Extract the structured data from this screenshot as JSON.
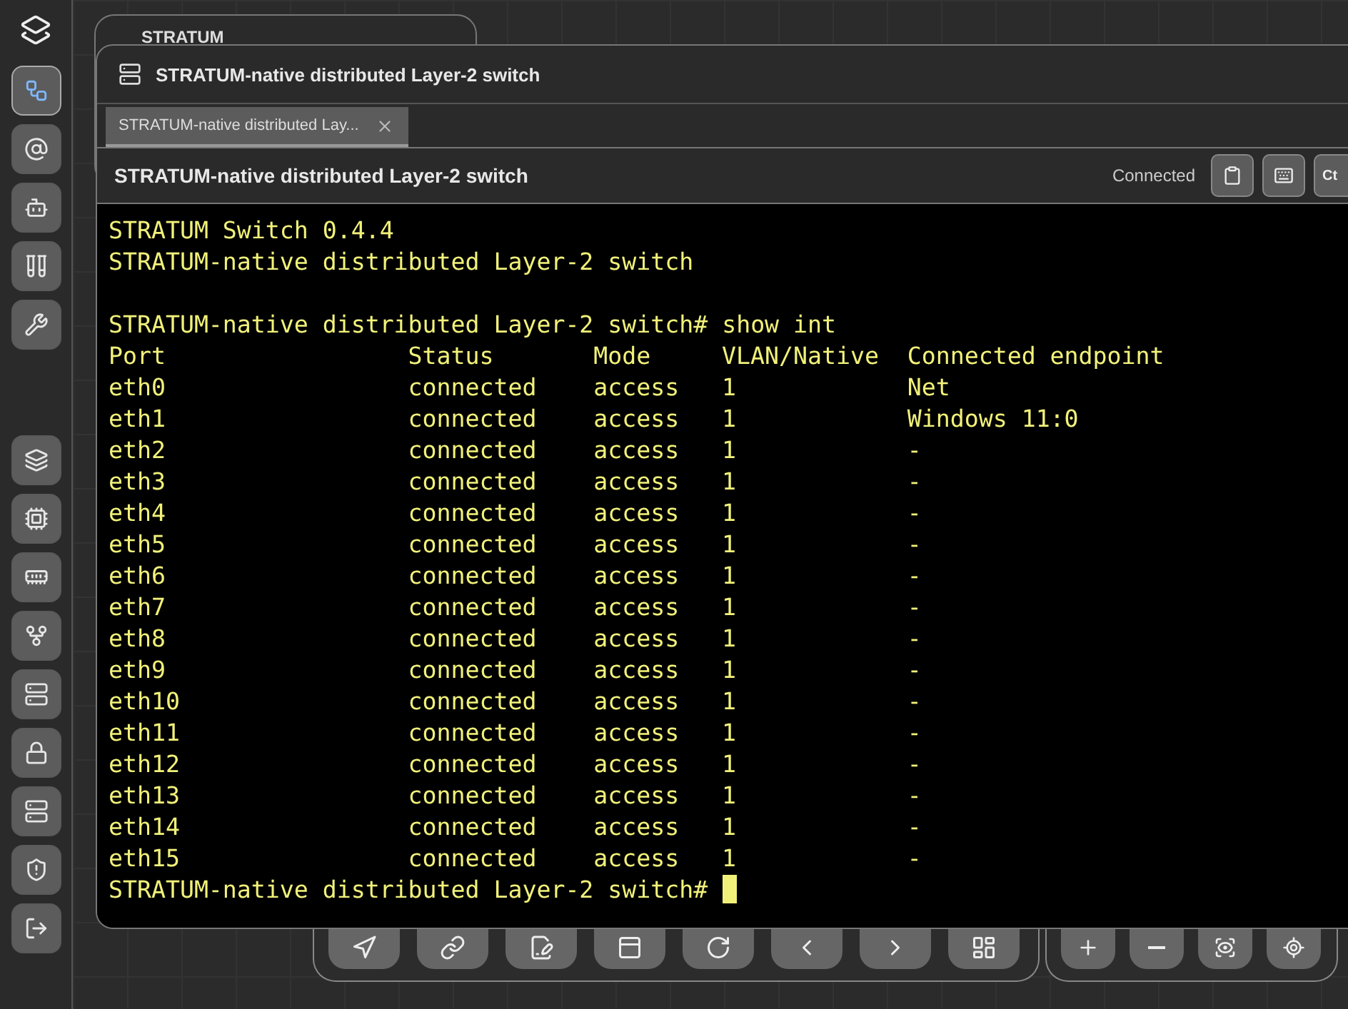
{
  "sidebar": {
    "items": [
      {
        "kind": "topology",
        "selected": true
      },
      {
        "kind": "radar",
        "selected": false
      },
      {
        "kind": "bot",
        "selected": false
      },
      {
        "kind": "tubes",
        "selected": false
      },
      {
        "kind": "robot-arm",
        "selected": false
      }
    ],
    "bottom_items": [
      {
        "kind": "layers",
        "selected": false
      },
      {
        "kind": "chip",
        "selected": false
      },
      {
        "kind": "card",
        "selected": false
      },
      {
        "kind": "fork",
        "selected": false
      },
      {
        "kind": "server",
        "selected": false
      },
      {
        "kind": "lock",
        "selected": false
      },
      {
        "kind": "server",
        "selected": false
      },
      {
        "kind": "shield",
        "selected": false
      },
      {
        "kind": "logout",
        "selected": false
      }
    ]
  },
  "background_card": {
    "title": "STRATUM"
  },
  "window": {
    "title": "STRATUM-native distributed Layer-2 switch",
    "tabs": [
      {
        "label": "STRATUM-native distributed Lay...",
        "selected": true
      }
    ],
    "header": {
      "title": "STRATUM-native distributed Layer-2 switch",
      "status": "Connected",
      "buttons": [
        {
          "kind": "clipboard"
        },
        {
          "kind": "keyboard"
        },
        {
          "kind": "text",
          "label": "Ct"
        }
      ]
    },
    "terminal": {
      "banner": [
        "STRATUM Switch 0.4.4",
        "STRATUM-native distributed Layer-2 switch"
      ],
      "command_line": "STRATUM-native distributed Layer-2 switch# show int",
      "table": {
        "columns": [
          "Port",
          "Status",
          "Mode",
          "VLAN/Native",
          "Connected endpoint"
        ],
        "rows": [
          [
            "eth0",
            "connected",
            "access",
            "1",
            "Net"
          ],
          [
            "eth1",
            "connected",
            "access",
            "1",
            "Windows 11:0"
          ],
          [
            "eth2",
            "connected",
            "access",
            "1",
            "-"
          ],
          [
            "eth3",
            "connected",
            "access",
            "1",
            "-"
          ],
          [
            "eth4",
            "connected",
            "access",
            "1",
            "-"
          ],
          [
            "eth5",
            "connected",
            "access",
            "1",
            "-"
          ],
          [
            "eth6",
            "connected",
            "access",
            "1",
            "-"
          ],
          [
            "eth7",
            "connected",
            "access",
            "1",
            "-"
          ],
          [
            "eth8",
            "connected",
            "access",
            "1",
            "-"
          ],
          [
            "eth9",
            "connected",
            "access",
            "1",
            "-"
          ],
          [
            "eth10",
            "connected",
            "access",
            "1",
            "-"
          ],
          [
            "eth11",
            "connected",
            "access",
            "1",
            "-"
          ],
          [
            "eth12",
            "connected",
            "access",
            "1",
            "-"
          ],
          [
            "eth13",
            "connected",
            "access",
            "1",
            "-"
          ],
          [
            "eth14",
            "connected",
            "access",
            "1",
            "-"
          ],
          [
            "eth15",
            "connected",
            "access",
            "1",
            "-"
          ]
        ]
      },
      "prompt": "STRATUM-native distributed Layer-2 switch#"
    }
  },
  "toolbar": {
    "tools": [
      {
        "kind": "pointer"
      },
      {
        "kind": "link"
      },
      {
        "kind": "edit"
      },
      {
        "kind": "panel"
      },
      {
        "kind": "redo"
      },
      {
        "kind": "back"
      },
      {
        "kind": "forward"
      },
      {
        "kind": "layout"
      }
    ],
    "zoom": [
      {
        "kind": "zoom-in"
      },
      {
        "kind": "zoom-out"
      },
      {
        "kind": "fit"
      },
      {
        "kind": "locate"
      }
    ]
  }
}
